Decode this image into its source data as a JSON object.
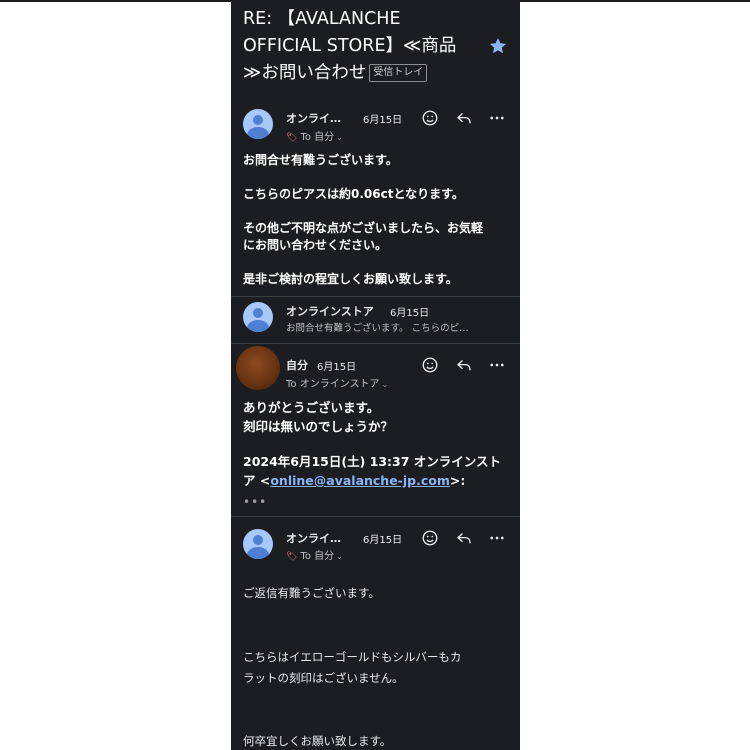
{
  "subject": {
    "line1": "RE: 【AVALANCHE",
    "line2": "OFFICIAL STORE】≪商品",
    "line3": "≫お問い合わせ",
    "label_tag": "受信トレイ"
  },
  "messages": [
    {
      "sender": "オンライ…",
      "date": "6月15日",
      "to": "To 自分",
      "body": [
        "お問合せ有難うございます。",
        "",
        "こちらのピアスは約0.06ctとなります。",
        "",
        "その他ご不明な点がございましたら、お気軽",
        "にお問い合わせください。",
        "",
        "是非ご検討の程宜しくお願い致します。"
      ]
    },
    {
      "sender": "オンラインストア",
      "date": "6月15日",
      "snippet": "お問合せ有難うございます。 こちらのピ…"
    },
    {
      "sender": "自分",
      "date": "6月15日",
      "to": "To オンラインストア",
      "body": [
        "ありがとうございます。",
        "刻印は無いのでしょうか？"
      ],
      "quote_prefix": "2024年6月15日(土) 13:37 オンラインストア <",
      "quote_email": "online@avalanche-jp.com",
      "quote_suffix": ">:",
      "more": "•••"
    },
    {
      "sender": "オンライ…",
      "date": "6月15日",
      "to": "To 自分",
      "body": [
        "ご返信有難うございます。",
        "こちらはイエローゴールドもシルバーもカ",
        "ラットの刻印はございません。",
        "何卒宜しくお願い致します。"
      ]
    }
  ],
  "colors": {
    "background": "#1c1d20",
    "link": "#8ab4f8",
    "star": "#8ab4f8"
  },
  "icons": [
    "star-icon",
    "emoji-icon",
    "reply-icon",
    "more-icon",
    "label-icon",
    "chevron-down-icon"
  ]
}
